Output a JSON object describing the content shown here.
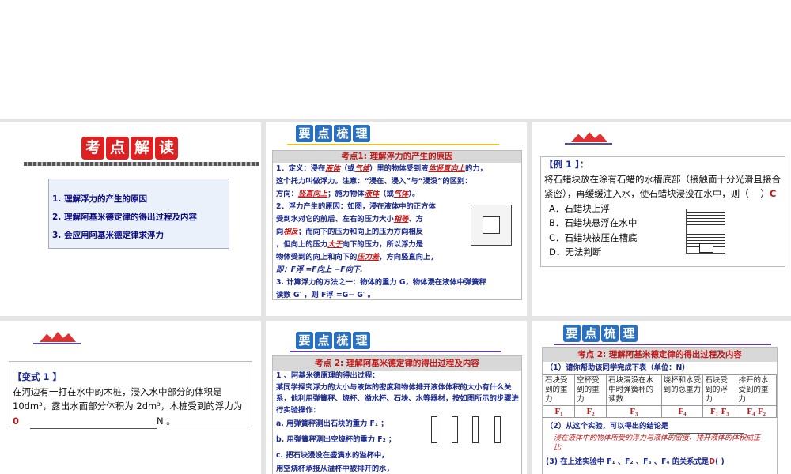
{
  "slides": [
    {
      "title_chars": [
        "考",
        "点",
        "解",
        "读"
      ],
      "goals": [
        "1. 理解浮力的产生的原因",
        "2. 理解阿基米德定律的得出过程及内容",
        "3. 会应用阿基米德定律求浮力"
      ]
    },
    {
      "header_chars": [
        "要",
        "点",
        "梳",
        "理"
      ],
      "panel_title": "考点1: 理解浮力的产生的原因",
      "l1a": "1．定义：浸在",
      "a1": "液体",
      "l1b": "（或",
      "a2": "气体",
      "l1c": "）里的物体受到液",
      "a3": "体竖直向上",
      "l1d": "的力，",
      "l2": "这个托力叫做浮力。注意：“浸在、浸入”与“浸没”的区别：",
      "l3a": "方向：",
      "a4": "竖直向上",
      "l3b": "；施力物体",
      "a5": "液体",
      "l3c": "（或",
      "a6": "气体",
      "l3d": "）。",
      "l4": "2．浮力产生的原因：如图，浸在液体中的正方体",
      "l5a": "受到水对它的前后、左右的压力大小",
      "a7": "相等",
      "l5b": "、方",
      "l6a": "向",
      "a8": "相反",
      "l6b": "；而向下的压力和向上的压力方向相反",
      "l7a": "，但向上的压力",
      "a9": "大于",
      "l7b": "向下的压力，所以浮力是",
      "l8a": "物体受到的向上和向下的",
      "a10": "压力差",
      "l8b": "，方向竖直向上，",
      "l9": "即：F浮 =F向上 −F向下.",
      "l10": "3. 计算浮力的方法之一：物体的重力 G，物体浸在液体中弹簧秤",
      "l11": "读数 G′ ，则 F浮 =G− G′ 。"
    },
    {
      "example_label": "【例 1 】：",
      "question": "将石蜡块放在涂有石蜡的水槽底部（接触面十分光滑且接合紧密），再缓缓注入水，使石蜡块浸没在水中，则（",
      "answer": "C",
      "close": "）",
      "options": [
        "A．石蜡块上浮",
        "B．石蜡块悬浮在水中",
        "C．石蜡块被压在槽底",
        "D．无法判断"
      ]
    },
    {
      "label": "【变式 1 】",
      "text1": "在河边有一打在水中的木桩，浸入水中部分的体积是10dm³，露出水面部分体积为 2dm³，木桩受到的浮力为",
      "answer": "0",
      "unit": "N 。"
    },
    {
      "header_chars": [
        "要",
        "点",
        "梳",
        "理"
      ],
      "panel_title": "考点 2: 理解阿基米德定律的得出过程及内容",
      "lines": [
        "1 、阿基米德原理的得出过程：",
        "某同学探究浮力的大小与液体的密度和物体排开液体体积的大小有什么关系，他利用弹簧秤、烧杯、溢水杯、石块、水等器材，按如图所示的步骤进行实验操作：",
        "a. 用弹簧秤测出石块的重力 F₁ ；",
        "b. 用弹簧秤测出空烧杯的重力 F₂ ；",
        "c. 把石块浸没在盛满水的溢杯中，",
        "用空烧杯承接从溢杯中被排开的水，"
      ]
    },
    {
      "header_chars": [
        "要",
        "点",
        "梳",
        "理"
      ],
      "panel_title": "考点 2: 理解阿基米德定律的得出过程及内容",
      "q1": "（1）请你帮助该同学完成下表（单位：N）",
      "table_headers": [
        "石块受到的重力",
        "空杯受到的重力",
        "石块浸没在水中时弹簧秤的读数",
        "烧杯和水受到的总重力",
        "石块受到的浮力",
        "排开的水受到的重力"
      ],
      "table_values": [
        "F₁",
        "F₂",
        "F₃",
        "F₄",
        "F₁-F₃",
        "F₄-F₂"
      ],
      "q2": "（2）从这个实验，可以得出的结论是",
      "conclusion": "浸在液体中的物体所受的浮力与液体的密度、排开液体的体积成正比",
      "q3": "(3)  在上述实验中 F₁ 、F₂ 、F₃ 、F₄ 的关系式是",
      "q3_answer": "D",
      "q3_tail": "(      )"
    }
  ]
}
